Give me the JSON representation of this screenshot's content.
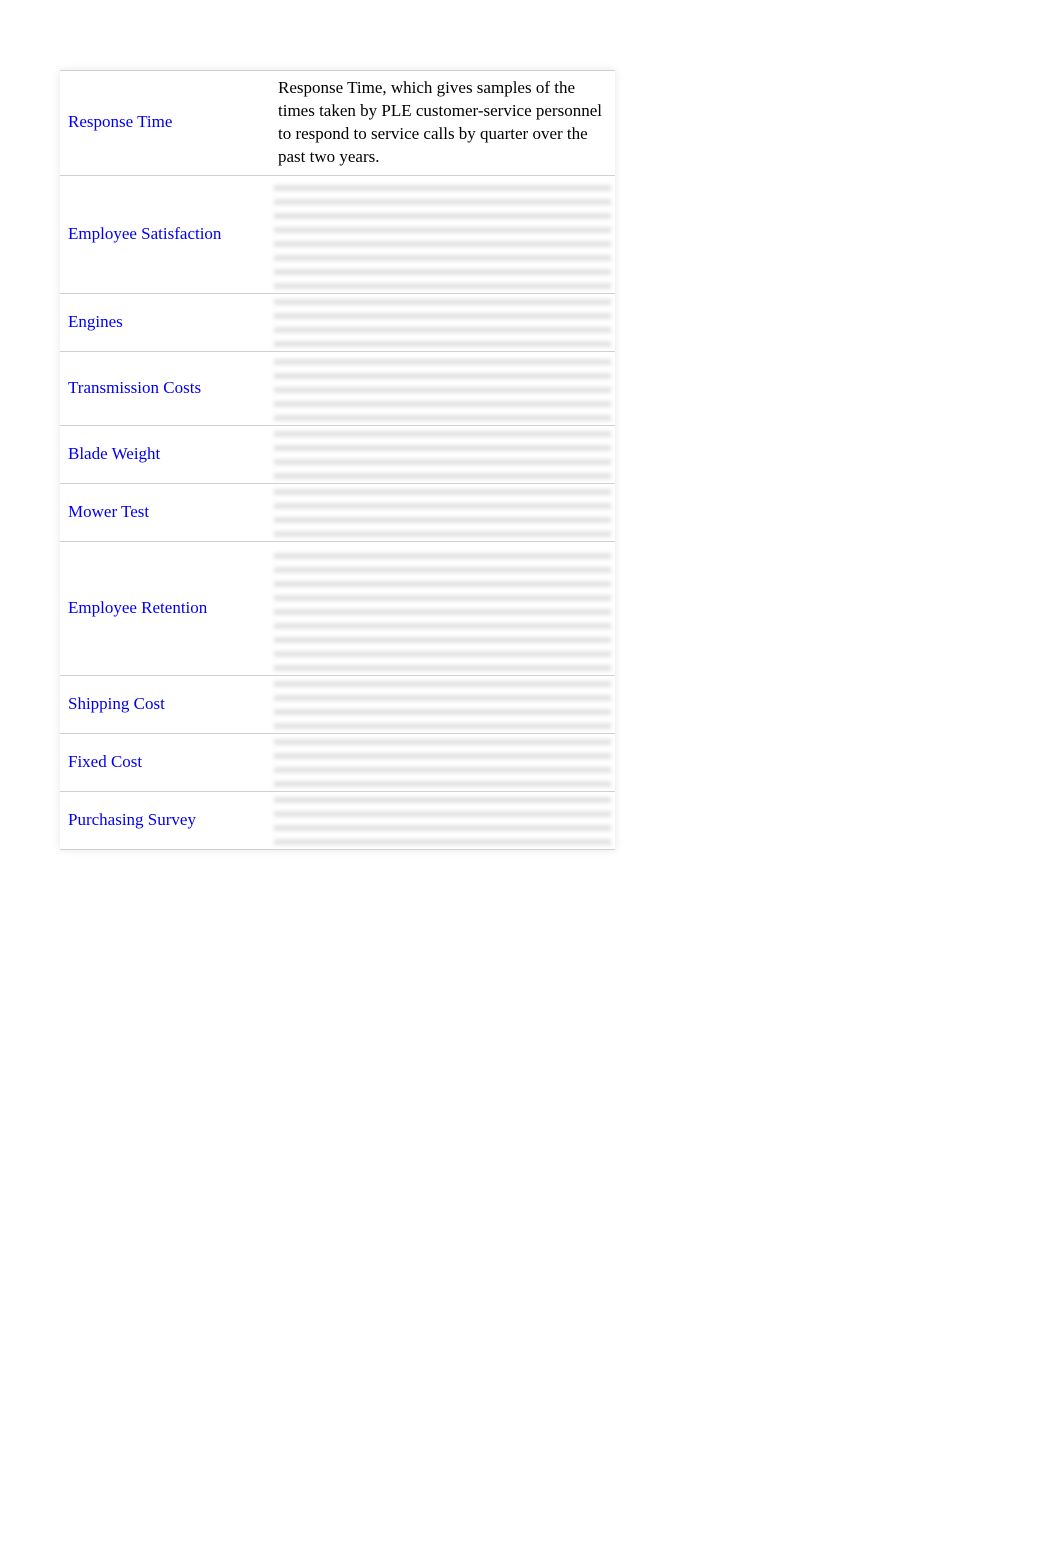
{
  "rows": [
    {
      "label": "Response Time",
      "desc": "Response Time, which gives samples of the times taken by PLE customer-service personnel to respond to service calls by quarter over the past two years.",
      "blurred": false,
      "hclass": ""
    },
    {
      "label": "Employee Satisfaction",
      "desc": "",
      "blurred": true,
      "hclass": "h-lines-7"
    },
    {
      "label": "Engines",
      "desc": "",
      "blurred": true,
      "hclass": "h-lines-3"
    },
    {
      "label": "Transmission Costs",
      "desc": "",
      "blurred": true,
      "hclass": "h-lines-4"
    },
    {
      "label": "Blade Weight",
      "desc": "",
      "blurred": true,
      "hclass": "h-lines-3"
    },
    {
      "label": "Mower Test",
      "desc": "",
      "blurred": true,
      "hclass": "h-lines-3"
    },
    {
      "label": "Employee Retention",
      "desc": "",
      "blurred": true,
      "hclass": "h-lines-8"
    },
    {
      "label": "Shipping Cost",
      "desc": "",
      "blurred": true,
      "hclass": "h-lines-3"
    },
    {
      "label": "Fixed Cost",
      "desc": "",
      "blurred": true,
      "hclass": "h-lines-3"
    },
    {
      "label": "Purchasing Survey",
      "desc": "",
      "blurred": true,
      "hclass": "h-lines-3"
    }
  ]
}
